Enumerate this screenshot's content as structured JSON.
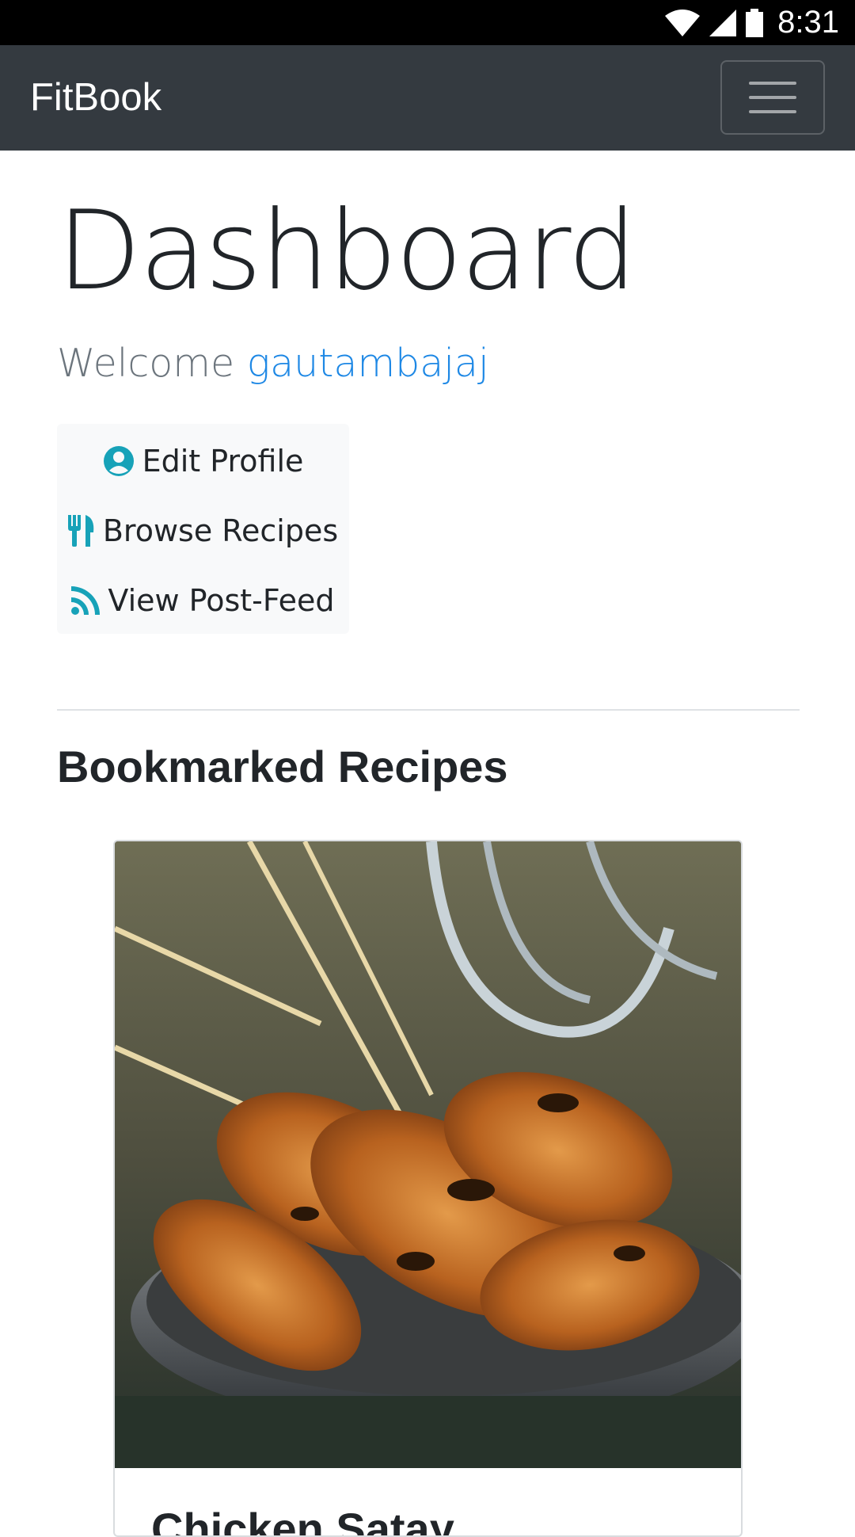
{
  "status_bar": {
    "time": "8:31",
    "icons": [
      "wifi-icon",
      "cell-signal-icon",
      "battery-icon"
    ]
  },
  "navbar": {
    "brand": "FitBook",
    "toggle_icon": "hamburger-menu-icon",
    "background": "#343a40"
  },
  "main": {
    "title": "Dashboard",
    "welcome_prefix": "Welcome",
    "username": "gautambajaj",
    "menu": [
      {
        "label": "Edit Profile",
        "icon": "user-circle-icon"
      },
      {
        "label": "Browse Recipes",
        "icon": "utensils-icon"
      },
      {
        "label": "View Post-Feed",
        "icon": "rss-icon"
      }
    ],
    "accent_color": "#17a2b8",
    "link_color": "#1e88e5"
  },
  "bookmarks": {
    "heading": "Bookmarked Recipes",
    "recipes": [
      {
        "title": "Chicken Satay",
        "image": "chicken-satay-photo"
      }
    ]
  }
}
